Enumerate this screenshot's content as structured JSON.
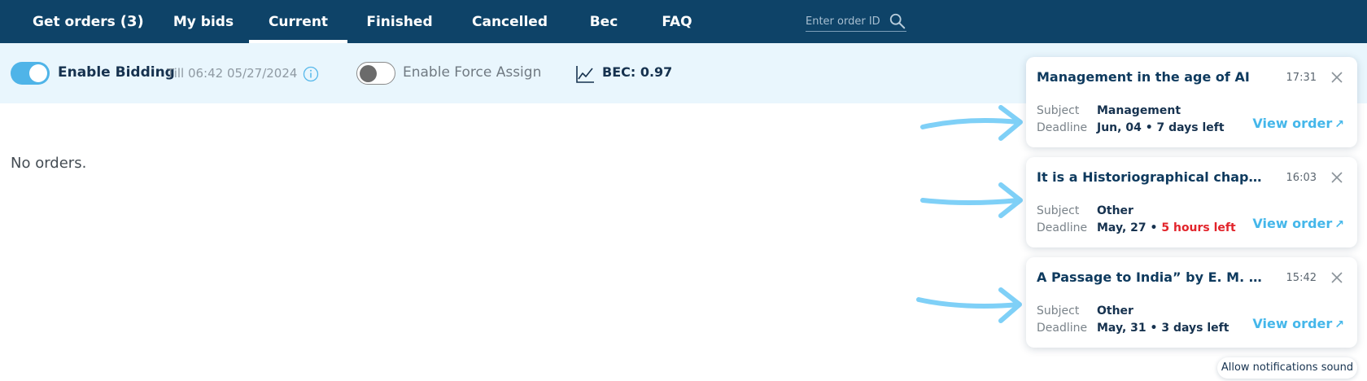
{
  "nav": {
    "tabs": [
      {
        "label": "Get orders",
        "count": "(3)"
      },
      {
        "label": "My bids"
      },
      {
        "label": "Current"
      },
      {
        "label": "Finished"
      },
      {
        "label": "Cancelled"
      },
      {
        "label": "Bec"
      },
      {
        "label": "FAQ"
      }
    ],
    "active_tab": "Current",
    "search": {
      "placeholder": "Enter order ID",
      "icon": "search-icon"
    }
  },
  "controls": {
    "bidding": {
      "label": "Enable Bidding",
      "enabled": true,
      "till": "Till 06:42 05/27/2024",
      "info_icon": "info-icon"
    },
    "force_assign": {
      "label": "Enable Force Assign",
      "enabled": false
    },
    "bec": {
      "label": "BEC: 0.97",
      "icon": "chart-line-icon"
    }
  },
  "main": {
    "empty_text": "No orders."
  },
  "notifications": [
    {
      "title": "Management in the age of AI",
      "time": "17:31",
      "subject_label": "Subject",
      "subject": "Management",
      "deadline_label": "Deadline",
      "deadline_date": "Jun, 04 •",
      "deadline_left": "7 days left",
      "urgent": false,
      "view_label": "View order"
    },
    {
      "title": "It is a Historiographical chapt...",
      "time": "16:03",
      "subject_label": "Subject",
      "subject": "Other",
      "deadline_label": "Deadline",
      "deadline_date": "May, 27 •",
      "deadline_left": "5 hours left",
      "urgent": true,
      "view_label": "View order"
    },
    {
      "title": "A Passage to India” by E. M. Fo...",
      "time": "15:42",
      "subject_label": "Subject",
      "subject": "Other",
      "deadline_label": "Deadline",
      "deadline_date": "May, 31 •",
      "deadline_left": "3 days left",
      "urgent": false,
      "view_label": "View order"
    }
  ],
  "sound_button": {
    "label": "Allow notifications sound"
  },
  "colors": {
    "nav_bg": "#0e4368",
    "strip_bg": "#e9f6fd",
    "accent": "#4fb4e8",
    "urgent": "#e2242b",
    "arrow": "#7fd0f7"
  }
}
